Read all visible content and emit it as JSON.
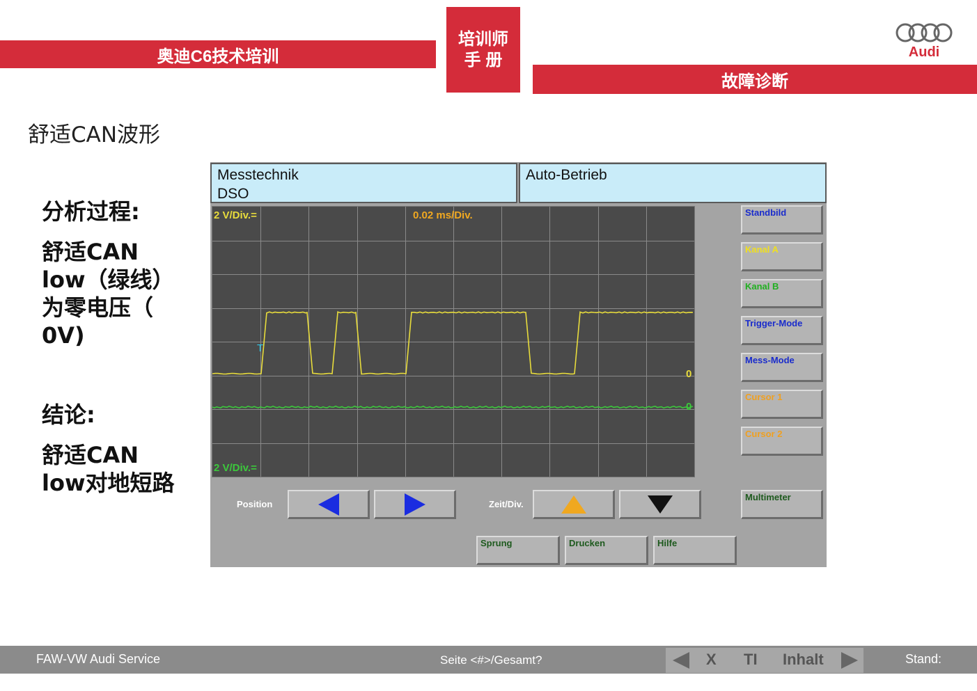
{
  "header": {
    "left_title": "奥迪C6技术培训",
    "center_line1": "培训师",
    "center_line2": "手 册",
    "right_title": "故障诊断",
    "logo_text": "Audi"
  },
  "slide_title": "舒适CAN波形",
  "left_panel": {
    "analysis_heading": "分析过程:",
    "analysis_lines": [
      "舒适CAN",
      "low（绿线）",
      "为零电压（",
      "0V)"
    ],
    "conclusion_heading": "结论:",
    "conclusion_lines": [
      "舒适CAN",
      "low对地短路"
    ]
  },
  "dso": {
    "header_left_line1": "Messtechnik",
    "header_left_line2": "DSO",
    "header_right": "Auto-Betrieb",
    "scope": {
      "channel_a_label": "2 V/Div.=",
      "timebase_label": "0.02 ms/Div.",
      "channel_b_label": "2 V/Div.=",
      "trigger_marker": "T",
      "zero_marker_a": "0",
      "zero_marker_b": "0"
    },
    "side_buttons": [
      {
        "label": "Standbild",
        "color": "#1a2ccc"
      },
      {
        "label": "Kanal A",
        "color": "#f0e020"
      },
      {
        "label": "Kanal B",
        "color": "#20b020"
      },
      {
        "label": "Trigger-Mode",
        "color": "#1a2ccc"
      },
      {
        "label": "Mess-Mode",
        "color": "#1a2ccc"
      },
      {
        "label": "Cursor 1",
        "color": "#f0a020"
      },
      {
        "label": "Cursor 2",
        "color": "#f0a020"
      },
      {
        "label": "Multimeter",
        "color": "#1e5a1e"
      }
    ],
    "controls": {
      "position_label": "Position",
      "zeit_label": "Zeit/Div."
    },
    "bottom_buttons": [
      "Sprung",
      "Drucken",
      "Hilfe"
    ],
    "colors": {
      "channel_a": "#e8dc3c",
      "channel_b": "#3cc83c",
      "grid": "#8a8a8a",
      "arrow_blue": "#1a2ce0",
      "arrow_orange": "#f0a820"
    }
  },
  "footer": {
    "left": "FAW-VW Audi Service",
    "center": "Seite <#>/Gesamt?",
    "nav_x": "X",
    "nav_t": "TI",
    "nav_inhalt": "Inhalt",
    "right": "Stand:"
  }
}
